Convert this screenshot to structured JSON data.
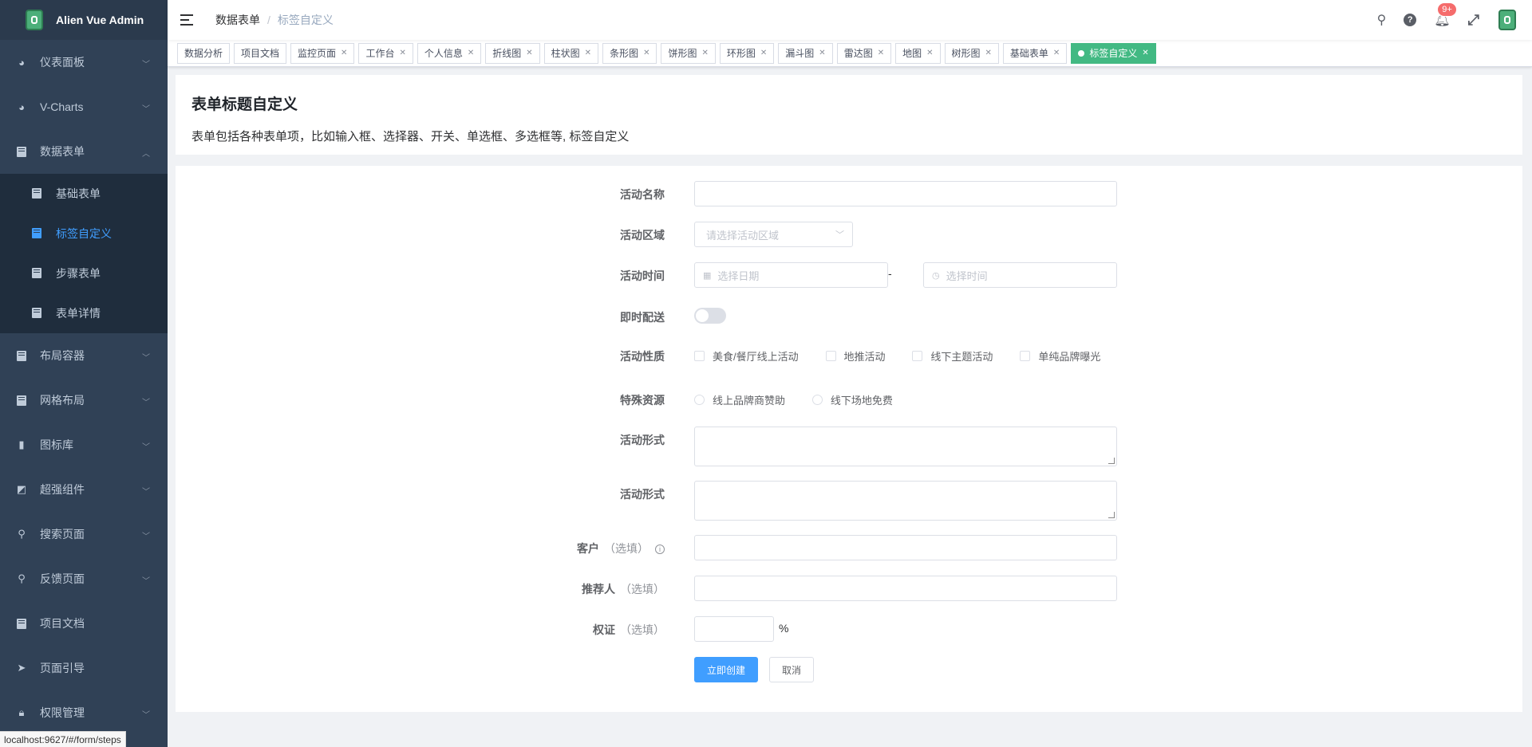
{
  "app": {
    "title": "Alien Vue Admin"
  },
  "sidebar": {
    "items": [
      {
        "label": "仪表面板"
      },
      {
        "label": "V-Charts"
      },
      {
        "label": "数据表单"
      },
      {
        "label": "布局容器"
      },
      {
        "label": "网格布局"
      },
      {
        "label": "图标库"
      },
      {
        "label": "超强组件"
      },
      {
        "label": "搜索页面"
      },
      {
        "label": "反馈页面"
      },
      {
        "label": "项目文档"
      },
      {
        "label": "页面引导"
      },
      {
        "label": "权限管理"
      }
    ],
    "subitems": [
      {
        "label": "基础表单"
      },
      {
        "label": "标签自定义"
      },
      {
        "label": "步骤表单"
      },
      {
        "label": "表单详情"
      }
    ]
  },
  "breadcrumb": {
    "parent": "数据表单",
    "current": "标签自定义"
  },
  "header": {
    "badge": "9+"
  },
  "tags": [
    {
      "label": "数据分析"
    },
    {
      "label": "项目文档"
    },
    {
      "label": "监控页面"
    },
    {
      "label": "工作台"
    },
    {
      "label": "个人信息"
    },
    {
      "label": "折线图"
    },
    {
      "label": "柱状图"
    },
    {
      "label": "条形图"
    },
    {
      "label": "饼形图"
    },
    {
      "label": "环形图"
    },
    {
      "label": "漏斗图"
    },
    {
      "label": "雷达图"
    },
    {
      "label": "地图"
    },
    {
      "label": "树形图"
    },
    {
      "label": "基础表单"
    },
    {
      "label": "标签自定义"
    }
  ],
  "page": {
    "title": "表单标题自定义",
    "description": "表单包括各种表单项，比如输入框、选择器、开关、单选框、多选框等, 标签自定义"
  },
  "form": {
    "name_label": "活动名称",
    "region_label": "活动区域",
    "region_placeholder": "请选择活动区域",
    "time_label": "活动时间",
    "date_placeholder": "选择日期",
    "time_sep": "-",
    "time_placeholder": "选择时间",
    "delivery_label": "即时配送",
    "type_label": "活动性质",
    "types": [
      "美食/餐厅线上活动",
      "地推活动",
      "线下主题活动",
      "单纯品牌曝光"
    ],
    "resource_label": "特殊资源",
    "resources": [
      "线上品牌商赞助",
      "线下场地免费"
    ],
    "form_label_1": "活动形式",
    "form_label_2": "活动形式",
    "client_label": "客户",
    "referrer_label": "推荐人",
    "equity_label": "权证",
    "optional": "（选填）",
    "percent": "%",
    "submit": "立即创建",
    "cancel": "取消"
  },
  "status": {
    "url": "localhost:9627/#/form/steps"
  }
}
